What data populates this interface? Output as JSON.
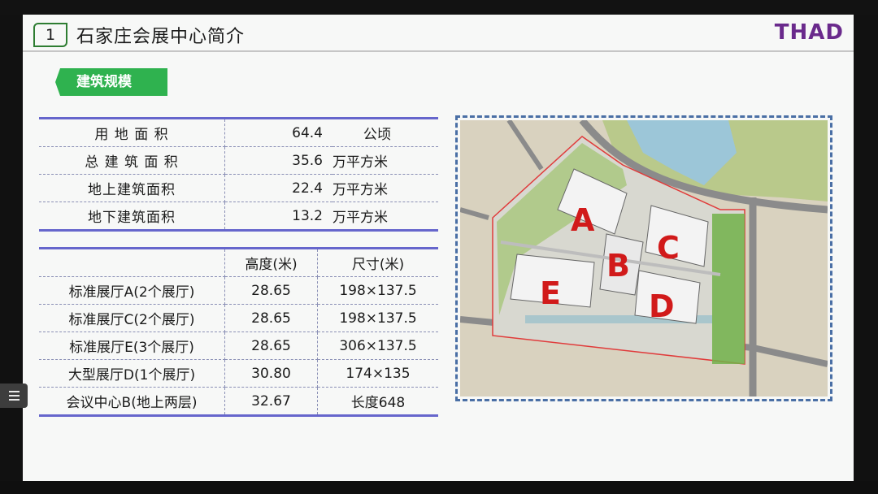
{
  "slide": {
    "number": "1",
    "title": "石家庄会展中心简介",
    "brand": "THAD",
    "section_tag": "建筑规模"
  },
  "area_table": {
    "rows": [
      {
        "label": "用 地 面 积",
        "value": "64.4",
        "unit": "公顷"
      },
      {
        "label": "总 建 筑 面 积",
        "value": "35.6",
        "unit": "万平方米"
      },
      {
        "label": "地上建筑面积",
        "value": "22.4",
        "unit": "万平方米"
      },
      {
        "label": "地下建筑面积",
        "value": "13.2",
        "unit": "万平方米"
      }
    ]
  },
  "hall_table": {
    "headers": [
      "",
      "高度(米)",
      "尺寸(米)"
    ],
    "rows": [
      {
        "name": "标准展厅A(2个展厅)",
        "height": "28.65",
        "size": "198×137.5"
      },
      {
        "name": "标准展厅C(2个展厅)",
        "height": "28.65",
        "size": "198×137.5"
      },
      {
        "name": "标准展厅E(3个展厅)",
        "height": "28.65",
        "size": "306×137.5"
      },
      {
        "name": "大型展厅D(1个展厅)",
        "height": "30.80",
        "size": "174×135"
      },
      {
        "name": "会议中心B(地上两层)",
        "height": "32.67",
        "size": "长度648"
      }
    ]
  },
  "site_map": {
    "labels": [
      "A",
      "B",
      "C",
      "D",
      "E"
    ],
    "label_color": "#d11a1a"
  },
  "footer": {
    "text": ""
  },
  "colors": {
    "accent_green": "#2fb24f",
    "brand_purple": "#6a2a8c",
    "table_rule": "#6666cc"
  },
  "icons": {
    "menu": "list-menu-icon"
  }
}
